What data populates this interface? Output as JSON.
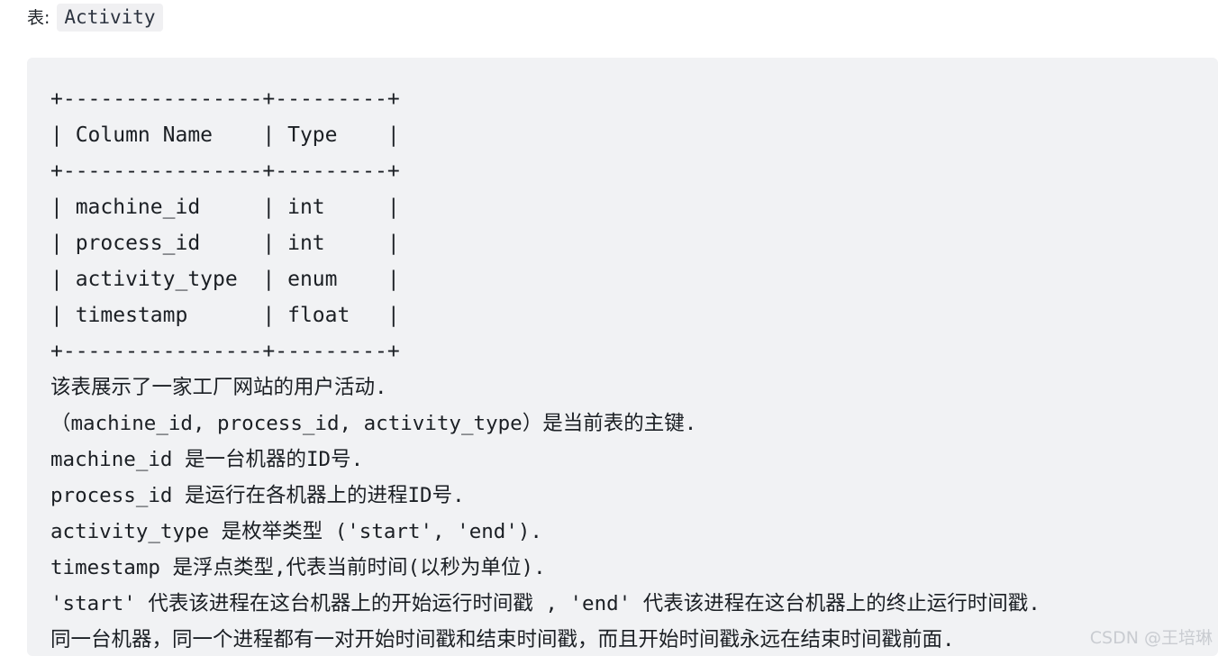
{
  "header": {
    "prefix": "表:",
    "table_name": "Activity"
  },
  "schema_block": {
    "background_color": "#f1f2f4",
    "ascii_table": [
      "+----------------+---------+",
      "| Column Name    | Type    |",
      "+----------------+---------+",
      "| machine_id     | int     |",
      "| process_id     | int     |",
      "| activity_type  | enum    |",
      "| timestamp      | float   |",
      "+----------------+---------+"
    ],
    "columns": [
      {
        "name": "machine_id",
        "type": "int"
      },
      {
        "name": "process_id",
        "type": "int"
      },
      {
        "name": "activity_type",
        "type": "enum"
      },
      {
        "name": "timestamp",
        "type": "float"
      }
    ],
    "column_headers": [
      "Column Name",
      "Type"
    ],
    "description_lines": [
      "该表展示了一家工厂网站的用户活动.",
      "（machine_id, process_id, activity_type）是当前表的主键.",
      "machine_id 是一台机器的ID号.",
      "process_id 是运行在各机器上的进程ID号.",
      "activity_type 是枚举类型 ('start', 'end').",
      "timestamp 是浮点类型,代表当前时间(以秒为单位).",
      "'start' 代表该进程在这台机器上的开始运行时间戳 , 'end' 代表该进程在这台机器上的终止运行时间戳.",
      "同一台机器，同一个进程都有一对开始时间戳和结束时间戳，而且开始时间戳永远在结束时间戳前面."
    ]
  },
  "watermark": {
    "text": "CSDN @王培琳",
    "color": "#c9ccd1"
  }
}
